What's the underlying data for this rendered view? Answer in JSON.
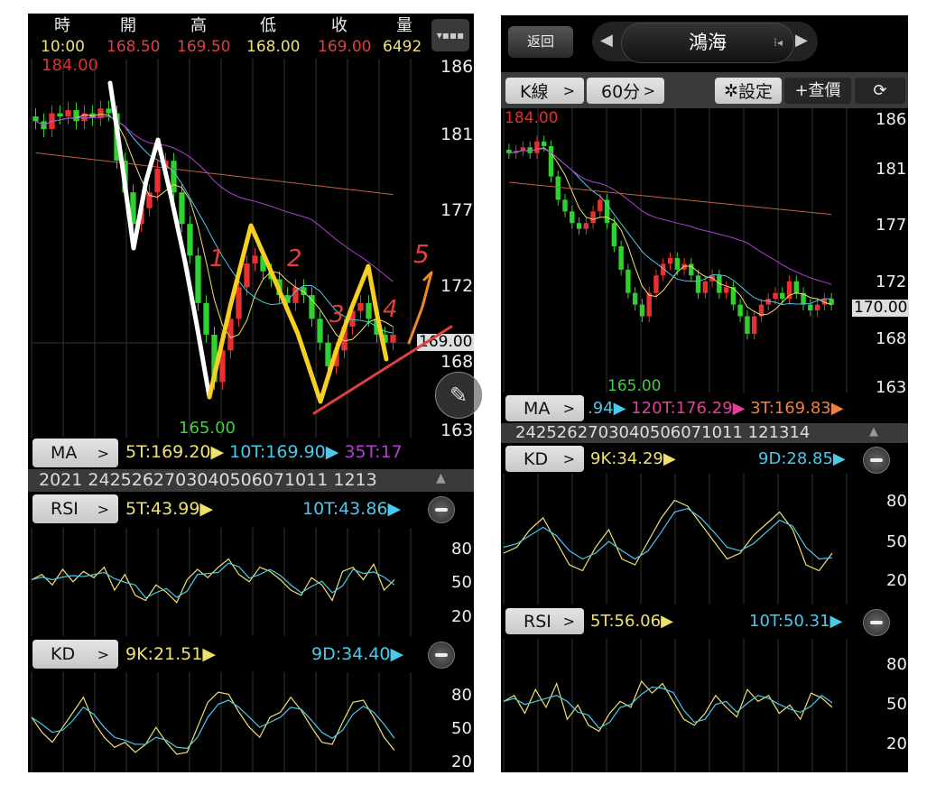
{
  "left": {
    "header_labels": [
      "時",
      "開",
      "高",
      "低",
      "收",
      "量"
    ],
    "header_values": [
      "10:00",
      "168.50",
      "169.50",
      "168.00",
      "169.00",
      "6492"
    ],
    "max_label": "184.00",
    "min_label": "165.00",
    "price_axis": [
      "186",
      "181",
      "177",
      "172",
      "168",
      "163"
    ],
    "current_price": "169.00",
    "ma": {
      "button": "MA",
      "t5": "5T:169.20",
      "t10": "10T:169.90",
      "t35": "35T:17"
    },
    "dates": "2021 2425262703040506071011 1213",
    "rsi": {
      "button": "RSI",
      "t5": "5T:43.99",
      "t10": "10T:43.86",
      "axis": [
        "80",
        "50",
        "20"
      ]
    },
    "kd": {
      "button": "KD",
      "k": "9K:21.51",
      "d": "9D:34.40",
      "axis": [
        "80",
        "50",
        "20"
      ]
    },
    "annotations": [
      "1",
      "2",
      "3",
      "4",
      "5"
    ],
    "closes": [
      182.5,
      182,
      183,
      182.8,
      183.2,
      182.5,
      183,
      182.7,
      183.3,
      183,
      180,
      178,
      176,
      177,
      178,
      179.5,
      180,
      178,
      176,
      174,
      171,
      169,
      166,
      168,
      170,
      172,
      173.5,
      174,
      173,
      172.5,
      171.5,
      171,
      172,
      171.5,
      170,
      168.5,
      167,
      168,
      169.5,
      170.5,
      171,
      170,
      169,
      168.5,
      169
    ],
    "rsi_series": [
      50,
      55,
      45,
      60,
      48,
      58,
      52,
      62,
      40,
      55,
      35,
      30,
      45,
      38,
      28,
      50,
      60,
      52,
      62,
      70,
      55,
      48,
      62,
      58,
      50,
      40,
      35,
      52,
      45,
      30,
      58,
      62,
      50,
      65,
      40,
      50
    ],
    "kd_k": [
      55,
      40,
      30,
      45,
      60,
      75,
      50,
      35,
      25,
      30,
      20,
      28,
      45,
      30,
      18,
      20,
      45,
      70,
      80,
      78,
      60,
      45,
      35,
      55,
      60,
      75,
      62,
      45,
      30,
      28,
      50,
      70,
      72,
      55,
      35,
      22
    ],
    "kd_d": [
      55,
      48,
      40,
      42,
      52,
      65,
      58,
      45,
      35,
      32,
      28,
      28,
      35,
      32,
      25,
      24,
      35,
      55,
      68,
      72,
      65,
      55,
      45,
      50,
      55,
      65,
      63,
      52,
      40,
      34,
      42,
      58,
      66,
      60,
      48,
      34
    ]
  },
  "right": {
    "back": "返回",
    "stock": "鴻海",
    "toolbar": {
      "kline": "K線",
      "period": "60分",
      "settings": "設定",
      "quote": "+查價"
    },
    "max_label": "184.00",
    "min_label": "165.00",
    "price_axis": [
      "186",
      "181",
      "177",
      "172",
      "168",
      "163"
    ],
    "current_price": "170.00",
    "ma": {
      "button": "MA",
      "t10": ".94",
      "t120": "120T:176.29",
      "t3": "3T:169.83"
    },
    "dates": "2425262703040506071011 121314",
    "kd": {
      "button": "KD",
      "k": "9K:34.29",
      "d": "9D:28.85",
      "axis": [
        "80",
        "50",
        "20"
      ]
    },
    "rsi": {
      "button": "RSI",
      "t5": "5T:56.06",
      "t10": "10T:50.31",
      "axis": [
        "80",
        "50",
        "20"
      ]
    },
    "closes": [
      183,
      183.2,
      183.5,
      183,
      184,
      183.6,
      181,
      179,
      178,
      177,
      176.5,
      177,
      178,
      179,
      177,
      175,
      173,
      171,
      170,
      169,
      171,
      172.5,
      173.5,
      174,
      173,
      173.5,
      172.5,
      171,
      172,
      172.5,
      171,
      171.5,
      170,
      169,
      167.5,
      169,
      170,
      170.5,
      171,
      170.5,
      172,
      171,
      170,
      169.5,
      170,
      170.5,
      170
    ],
    "kd_k": [
      40,
      45,
      60,
      70,
      50,
      30,
      25,
      45,
      60,
      35,
      30,
      50,
      70,
      85,
      80,
      65,
      50,
      35,
      40,
      55,
      65,
      75,
      60,
      30,
      25,
      40
    ],
    "kd_d": [
      45,
      48,
      55,
      62,
      55,
      42,
      35,
      40,
      50,
      42,
      35,
      42,
      58,
      75,
      78,
      70,
      58,
      45,
      42,
      48,
      58,
      68,
      63,
      45,
      35,
      36
    ],
    "rsi_series": [
      55,
      60,
      45,
      65,
      50,
      70,
      40,
      52,
      35,
      30,
      45,
      55,
      50,
      72,
      62,
      70,
      55,
      40,
      35,
      45,
      60,
      50,
      42,
      65,
      55,
      60,
      45,
      52,
      40,
      62,
      58,
      50
    ]
  }
}
